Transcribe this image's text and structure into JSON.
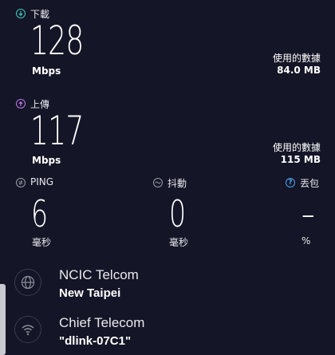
{
  "download": {
    "label": "下載",
    "value": "128",
    "unit": "Mbps",
    "used_label": "使用的數據",
    "used_value": "84.0 MB",
    "color": "#3ec8c0"
  },
  "upload": {
    "label": "上傳",
    "value": "117",
    "unit": "Mbps",
    "used_label": "使用的數據",
    "used_value": "115 MB",
    "color": "#c27ae8"
  },
  "ping": {
    "label": "PING",
    "value": "6",
    "unit": "毫秒",
    "icon": "ping-icon"
  },
  "jitter": {
    "label": "抖動",
    "value": "0",
    "unit": "毫秒",
    "icon": "wave-icon"
  },
  "loss": {
    "label": "丟包",
    "value": "–",
    "unit": "%",
    "icon": "question-icon",
    "color": "#4aa3f0"
  },
  "server": {
    "provider": "NCIC Telcom",
    "location": "New Taipei",
    "icon": "globe-icon"
  },
  "network": {
    "provider": "Chief Telecom",
    "ssid": "\"dlink-07C1\"",
    "icon": "wifi-icon"
  }
}
